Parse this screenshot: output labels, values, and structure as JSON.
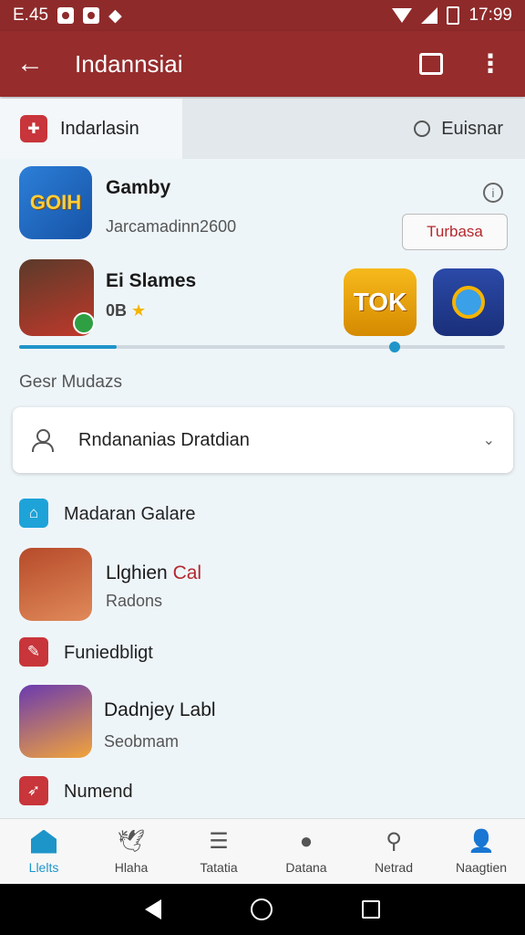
{
  "status_bar": {
    "time_left": "E.45",
    "time_right": "17:99"
  },
  "app_bar": {
    "title": "Indannsiai"
  },
  "tabs": [
    {
      "label": "Indarlasin"
    },
    {
      "label": "Euisnar"
    }
  ],
  "game1": {
    "title": "Gamby",
    "title_suffix": "y",
    "subtitle": "Jarcamadinn2600",
    "icon_text": "GOIH",
    "button_label": "Turbasa"
  },
  "game2": {
    "title": "Ei Slames",
    "rating": "0B",
    "star": "★",
    "tok_icon_text": "TOK"
  },
  "progress": {
    "fraction": 0.2
  },
  "section_label": "Gesr Mudazs",
  "dropdown": {
    "value": "Rndananias Dratdian"
  },
  "list": [
    {
      "label": "Madaran Galare"
    },
    {
      "title": "Llghien",
      "title_accent": "Cal",
      "subtitle": "Radons"
    },
    {
      "label": "Funiedbligt"
    },
    {
      "title": "Dadnjey Labl",
      "subtitle": "Seobmam"
    },
    {
      "label": "Numend"
    }
  ],
  "bottom_nav": [
    {
      "label": "Llelts",
      "icon": "home-icon"
    },
    {
      "label": "Hlaha",
      "icon": "bird-icon"
    },
    {
      "label": "Tatatia",
      "icon": "stack-icon"
    },
    {
      "label": "Datana",
      "icon": "chat-icon"
    },
    {
      "label": "Netrad",
      "icon": "search-icon"
    },
    {
      "label": "Naagtien",
      "icon": "person-icon"
    }
  ],
  "colors": {
    "primary": "#962c2c",
    "accent": "#1e95c9",
    "badge_red": "#c8353a"
  }
}
